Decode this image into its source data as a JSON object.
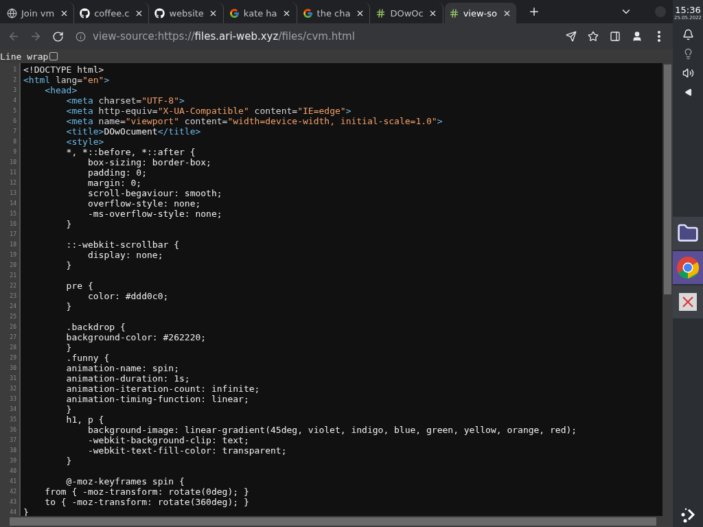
{
  "tabs": [
    {
      "title": "Join vm",
      "selected": false
    },
    {
      "title": "coffee.c",
      "selected": false
    },
    {
      "title": "website",
      "selected": false
    },
    {
      "title": "kate ha",
      "selected": false
    },
    {
      "title": "the cha",
      "selected": false
    },
    {
      "title": "DOwOc",
      "selected": false
    },
    {
      "title": "view-so",
      "selected": true
    }
  ],
  "toolbar": {
    "back_disabled": true,
    "forward_disabled": true,
    "url": {
      "scheme": "view-source:https://",
      "host": "files.ari-web.xyz",
      "path": "/files/cvm.html"
    }
  },
  "line_wrap": {
    "label": "Line wrap",
    "checked": false
  },
  "source_lines": [
    {
      "number": "1",
      "segments": [
        {
          "kind": "doctype",
          "text": "<!DOCTYPE html>"
        }
      ]
    },
    {
      "number": "2",
      "segments": [
        {
          "kind": "tag",
          "text": "<html"
        },
        {
          "kind": "attr",
          "text": " lang="
        },
        {
          "kind": "value",
          "text": "\"en\""
        },
        {
          "kind": "tag",
          "text": ">"
        }
      ]
    },
    {
      "number": "3",
      "segments": [
        {
          "kind": "tag",
          "text": "    <head>"
        }
      ]
    },
    {
      "number": "4",
      "segments": [
        {
          "kind": "tag",
          "text": "        <meta"
        },
        {
          "kind": "attr",
          "text": " charset="
        },
        {
          "kind": "value",
          "text": "\"UTF-8\""
        },
        {
          "kind": "tag",
          "text": ">"
        }
      ]
    },
    {
      "number": "5",
      "segments": [
        {
          "kind": "tag",
          "text": "        <meta"
        },
        {
          "kind": "attr",
          "text": " http-equiv="
        },
        {
          "kind": "value",
          "text": "\"X-UA-Compatible\""
        },
        {
          "kind": "attr",
          "text": " content="
        },
        {
          "kind": "value",
          "text": "\"IE=edge\""
        },
        {
          "kind": "tag",
          "text": ">"
        }
      ]
    },
    {
      "number": "6",
      "segments": [
        {
          "kind": "tag",
          "text": "        <meta"
        },
        {
          "kind": "attr",
          "text": " name="
        },
        {
          "kind": "value",
          "text": "\"viewport\""
        },
        {
          "kind": "attr",
          "text": " content="
        },
        {
          "kind": "value",
          "text": "\"width=device-width, initial-scale=1.0\""
        },
        {
          "kind": "tag",
          "text": ">"
        }
      ]
    },
    {
      "number": "7",
      "segments": [
        {
          "kind": "tag",
          "text": "        <title>"
        },
        {
          "kind": "text",
          "text": "DOwOcument"
        },
        {
          "kind": "tag",
          "text": "</title>"
        }
      ]
    },
    {
      "number": "8",
      "segments": [
        {
          "kind": "tag",
          "text": "        <style>"
        }
      ]
    },
    {
      "number": "9",
      "segments": [
        {
          "kind": "text",
          "text": "        *, *::before, *::after {"
        }
      ]
    },
    {
      "number": "10",
      "segments": [
        {
          "kind": "text",
          "text": "            box-sizing: border-box;"
        }
      ]
    },
    {
      "number": "11",
      "segments": [
        {
          "kind": "text",
          "text": "            padding: 0;"
        }
      ]
    },
    {
      "number": "12",
      "segments": [
        {
          "kind": "text",
          "text": "            margin: 0;"
        }
      ]
    },
    {
      "number": "13",
      "segments": [
        {
          "kind": "text",
          "text": "            scroll-begaviour: smooth;"
        }
      ]
    },
    {
      "number": "14",
      "segments": [
        {
          "kind": "text",
          "text": "            overflow-style: none;"
        }
      ]
    },
    {
      "number": "15",
      "segments": [
        {
          "kind": "text",
          "text": "            -ms-overflow-style: none;"
        }
      ]
    },
    {
      "number": "16",
      "segments": [
        {
          "kind": "text",
          "text": "        }"
        }
      ]
    },
    {
      "number": "17"
    },
    {
      "number": "18",
      "segments": [
        {
          "kind": "text",
          "text": "        ::-webkit-scrollbar {"
        }
      ]
    },
    {
      "number": "19",
      "segments": [
        {
          "kind": "text",
          "text": "            display: none;"
        }
      ]
    },
    {
      "number": "20",
      "segments": [
        {
          "kind": "text",
          "text": "        }"
        }
      ]
    },
    {
      "number": "21"
    },
    {
      "number": "22",
      "segments": [
        {
          "kind": "text",
          "text": "        pre {"
        }
      ]
    },
    {
      "number": "23",
      "segments": [
        {
          "kind": "text",
          "text": "            color: #ddd0c0;"
        }
      ]
    },
    {
      "number": "24",
      "segments": [
        {
          "kind": "text",
          "text": "        }"
        }
      ]
    },
    {
      "number": "25"
    },
    {
      "number": "26",
      "segments": [
        {
          "kind": "text",
          "text": "        .backdrop {"
        }
      ]
    },
    {
      "number": "27",
      "segments": [
        {
          "kind": "text",
          "text": "        background-color: #262220;"
        }
      ]
    },
    {
      "number": "28",
      "segments": [
        {
          "kind": "text",
          "text": "        }"
        }
      ]
    },
    {
      "number": "29",
      "segments": [
        {
          "kind": "text",
          "text": "        .funny {"
        }
      ]
    },
    {
      "number": "30",
      "segments": [
        {
          "kind": "text",
          "text": "        animation-name: spin;"
        }
      ]
    },
    {
      "number": "31",
      "segments": [
        {
          "kind": "text",
          "text": "        animation-duration: 1s;"
        }
      ]
    },
    {
      "number": "32",
      "segments": [
        {
          "kind": "text",
          "text": "        animation-iteration-count: infinite;"
        }
      ]
    },
    {
      "number": "33",
      "segments": [
        {
          "kind": "text",
          "text": "        animation-timing-function: linear;"
        }
      ]
    },
    {
      "number": "34",
      "segments": [
        {
          "kind": "text",
          "text": "        }"
        }
      ]
    },
    {
      "number": "35",
      "segments": [
        {
          "kind": "text",
          "text": "        h1, p {"
        }
      ]
    },
    {
      "number": "36",
      "segments": [
        {
          "kind": "text",
          "text": "            background-image: linear-gradient(45deg, violet, indigo, blue, green, yellow, orange, red);"
        }
      ]
    },
    {
      "number": "37",
      "segments": [
        {
          "kind": "text",
          "text": "            -webkit-background-clip: text;"
        }
      ]
    },
    {
      "number": "38",
      "segments": [
        {
          "kind": "text",
          "text": "            -webkit-text-fill-color: transparent;"
        }
      ]
    },
    {
      "number": "39",
      "segments": [
        {
          "kind": "text",
          "text": "        }"
        }
      ]
    },
    {
      "number": "40"
    },
    {
      "number": "41",
      "segments": [
        {
          "kind": "text",
          "text": "        @-moz-keyframes spin {"
        }
      ]
    },
    {
      "number": "42",
      "segments": [
        {
          "kind": "text",
          "text": "    from { -moz-transform: rotate(0deg); }"
        }
      ]
    },
    {
      "number": "43",
      "segments": [
        {
          "kind": "text",
          "text": "    to { -moz-transform: rotate(360deg); }"
        }
      ]
    },
    {
      "number": "44",
      "segments": [
        {
          "kind": "text",
          "text": "}"
        }
      ]
    }
  ],
  "system_panel": {
    "time": "15:36",
    "date": "25.05.2022",
    "apps": [
      {
        "selected": false
      },
      {
        "selected": true
      },
      {
        "selected": false
      }
    ]
  }
}
